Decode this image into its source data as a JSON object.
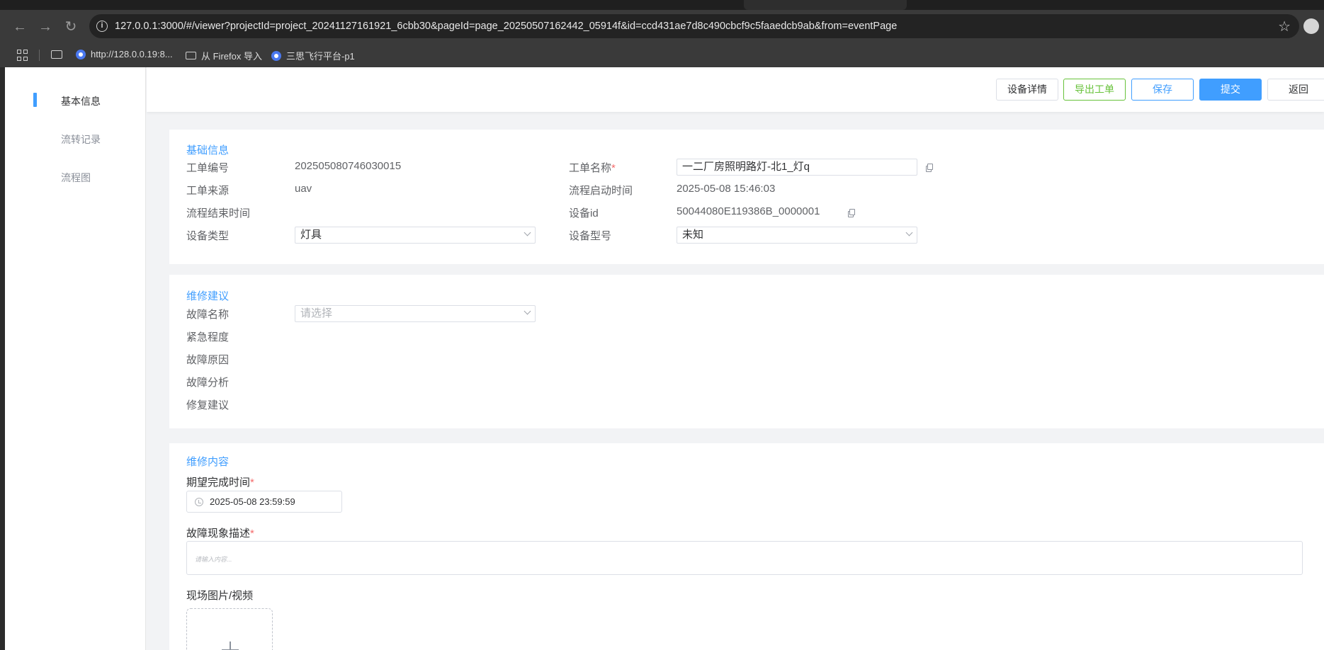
{
  "browser": {
    "url": "127.0.0.1:3000/#/viewer?projectId=project_20241127161921_6cbb30&pageId=page_20250507162442_05914f&id=ccd431ae7d8c490cbcf9c5faaedcb9ab&from=eventPage",
    "bookmarks": [
      "http://128.0.0.19:8...",
      "从 Firefox 导入",
      "三思飞行平台-p1"
    ]
  },
  "sidebar": {
    "items": [
      "基本信息",
      "流转记录",
      "流程图"
    ],
    "active_index": 0
  },
  "actions": {
    "detail": "设备详情",
    "export": "导出工单",
    "save": "保存",
    "submit": "提交",
    "back": "返回"
  },
  "basic": {
    "title": "基础信息",
    "order_no_label": "工单编号",
    "order_no": "202505080746030015",
    "name_label": "工单名称",
    "name_value": "一二厂房照明路灯-北1_灯q",
    "source_label": "工单来源",
    "source_value": "uav",
    "start_time_label": "流程启动时间",
    "start_time_value": "2025-05-08 15:46:03",
    "end_time_label": "流程结束时间",
    "device_id_label": "设备id",
    "device_id_value": "50044080E119386B_0000001",
    "device_type_label": "设备类型",
    "device_type_value": "灯具",
    "device_model_label": "设备型号",
    "device_model_value": "未知"
  },
  "advice": {
    "title": "维修建议",
    "fault_name_label": "故障名称",
    "fault_name_placeholder": "请选择",
    "urgency_label": "紧急程度",
    "cause_label": "故障原因",
    "analysis_label": "故障分析",
    "repair_label": "修复建议"
  },
  "content": {
    "title": "维修内容",
    "expected_time_label": "期望完成时间",
    "expected_time_value": "2025-05-08 23:59:59",
    "description_label": "故障现象描述",
    "description_placeholder": "请输入内容...",
    "media_label": "现场图片/视频"
  },
  "colors": {
    "primary": "#409eff",
    "success": "#67c23a",
    "required": "#f56c6c"
  }
}
